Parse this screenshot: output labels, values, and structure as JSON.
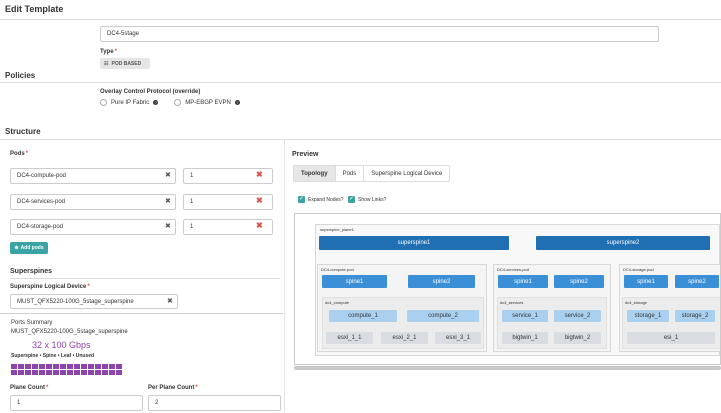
{
  "page": {
    "title": "Edit Template",
    "name_value": "DC4-5stage",
    "type_label": "Type",
    "type_value": "POD BASED"
  },
  "policies": {
    "title": "Policies",
    "overlay_label": "Overlay Control Protocol (override)",
    "options": [
      "Pure IP Fabric",
      "MP-EBGP EVPN"
    ]
  },
  "structure": {
    "title": "Structure",
    "pods_label": "Pods",
    "pods": [
      {
        "name": "DC4-compute-pod",
        "count": "1"
      },
      {
        "name": "DC4-services-pod",
        "count": "1"
      },
      {
        "name": "DC4-storage-pod",
        "count": "1"
      }
    ],
    "add_pods_label": "Add pods",
    "superspines_title": "Superspines",
    "ss_device_label": "Superspine Logical Device",
    "ss_device_value": "MUST_QFX5220-100G_5stage_superspine"
  },
  "ports": {
    "title": "Ports Summary",
    "device": "MUST_QFX5220-100G_5stage_superspine",
    "speed": "32 x 100 Gbps",
    "legend": "Superspine • Spine • Leaf • Unused",
    "port_count": 32
  },
  "counts": {
    "plane_label": "Plane Count",
    "plane_value": "1",
    "per_plane_label": "Per Plane Count",
    "per_plane_value": "2"
  },
  "preview": {
    "title": "Preview",
    "tabs": [
      "Topology",
      "Pods",
      "Superspine Logical Device"
    ],
    "expand_nodes": "Expand Nodes?",
    "show_links": "Show Links?",
    "plane_label": "superspine_plane1",
    "superspines": [
      "superspine1",
      "superspine2"
    ],
    "pods": [
      {
        "label": "DC4-compute-pod",
        "spines": [
          "spine1",
          "spine2"
        ],
        "rack": "dc4_compute",
        "leafs": [
          "compute_1",
          "compute_2"
        ],
        "servers": [
          "esxi_1_1",
          "esxi_2_1",
          "esxi_3_1"
        ]
      },
      {
        "label": "DC4-services-pod",
        "spines": [
          "spine1",
          "spine2"
        ],
        "rack": "dc4_services",
        "leafs": [
          "service_1",
          "service_2"
        ],
        "servers": [
          "bigtwin_1",
          "bigtwin_2"
        ]
      },
      {
        "label": "DC4-storage-pod",
        "spines": [
          "spine1",
          "spine2"
        ],
        "rack": "dc4_storage",
        "leafs": [
          "storage_1",
          "storage_2"
        ],
        "servers": [
          "esi_1"
        ]
      }
    ]
  },
  "colors": {
    "accent": "#3aa3a3",
    "superspine": "#1f6fb2",
    "spine": "#3b8fd6",
    "leaf": "#aad0ef",
    "server": "#d9dde2",
    "port": "#8e44ad",
    "required": "#d9534f"
  },
  "icons": {
    "pod_type": "sitemap-icon",
    "help": "question-circle-icon",
    "clear": "times-icon",
    "delete": "times-red-icon",
    "add": "plus-circle-icon",
    "checkbox": "check-icon"
  }
}
